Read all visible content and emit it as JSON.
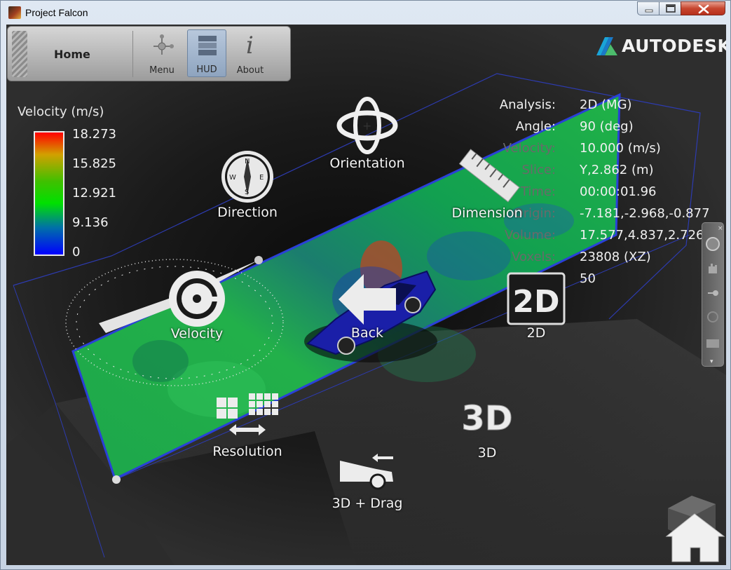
{
  "window": {
    "title": "Project Falcon",
    "controls": [
      "minimize",
      "maximize",
      "close"
    ]
  },
  "toolbar": {
    "home_label": "Home",
    "items": [
      {
        "label": "Menu",
        "icon": "menu-icon"
      },
      {
        "label": "HUD",
        "icon": "hud-icon",
        "active": true
      },
      {
        "label": "About",
        "icon": "info-icon"
      }
    ]
  },
  "logo": {
    "text": "AUTODESK."
  },
  "legend": {
    "title": "Velocity (m/s)",
    "ticks": [
      "18.273",
      "15.825",
      "12.921",
      "9.136",
      "0"
    ],
    "colors": [
      "#ff0000",
      "#d2a000",
      "#40c000",
      "#00e000",
      "#0070a8",
      "#0000ff"
    ]
  },
  "info": [
    {
      "label": "Analysis:",
      "value": "2D (MG)"
    },
    {
      "label": "Angle:",
      "value": "90 (deg)"
    },
    {
      "label": "Velocity:",
      "value": "10.000 (m/s)"
    },
    {
      "label": "Slice:",
      "value": "Y,2.862 (m)"
    },
    {
      "label": "Time:",
      "value": "00:00:01.96"
    },
    {
      "label": "Origin:",
      "value": "-7.181,-2.968,-0.877"
    },
    {
      "label": "Volume:",
      "value": "17.577,4.837,2.726"
    },
    {
      "label": "Voxels:",
      "value": "23808 (XZ)"
    },
    {
      "label": "FPS:",
      "value": "50"
    }
  ],
  "radial_menu": {
    "orientation": "Orientation",
    "direction": "Direction",
    "dimension": "Dimension",
    "velocity": "Velocity",
    "back": "Back",
    "mode_2d": "2D",
    "mode_2d_icon": "2D",
    "resolution": "Resolution",
    "mode_3d": "3D",
    "mode_3d_icon": "3D",
    "drag": "3D + Drag"
  },
  "compass_letters": [
    "N",
    "E",
    "S",
    "W"
  ]
}
